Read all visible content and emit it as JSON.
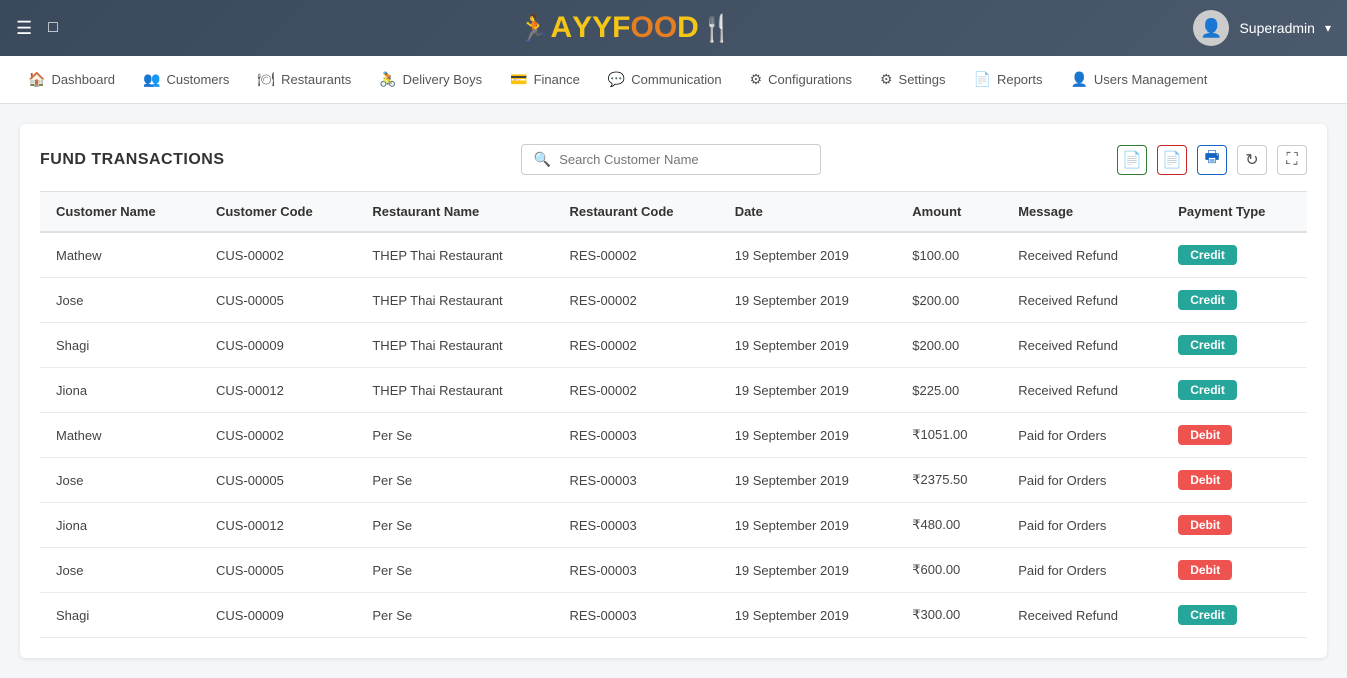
{
  "header": {
    "logo_text": "AYYFOOD",
    "user_name": "Superadmin",
    "chevron": "▾"
  },
  "navbar": {
    "items": [
      {
        "label": "Dashboard",
        "icon": "🏠"
      },
      {
        "label": "Customers",
        "icon": "👥"
      },
      {
        "label": "Restaurants",
        "icon": "🍽"
      },
      {
        "label": "Delivery Boys",
        "icon": "🚴"
      },
      {
        "label": "Finance",
        "icon": "💳"
      },
      {
        "label": "Communication",
        "icon": "💬"
      },
      {
        "label": "Configurations",
        "icon": "⚙"
      },
      {
        "label": "Settings",
        "icon": "⚙"
      },
      {
        "label": "Reports",
        "icon": "📄"
      },
      {
        "label": "Users Management",
        "icon": "👤"
      }
    ]
  },
  "page": {
    "title": "FUND TRANSACTIONS",
    "search_placeholder": "Search Customer Name"
  },
  "table": {
    "columns": [
      "Customer Name",
      "Customer Code",
      "Restaurant Name",
      "Restaurant Code",
      "Date",
      "Amount",
      "Message",
      "Payment Type"
    ],
    "rows": [
      {
        "customer_name": "Mathew",
        "customer_code": "CUS-00002",
        "restaurant_name": "THEP Thai Restaurant",
        "restaurant_code": "RES-00002",
        "date": "19 September 2019",
        "amount": "$100.00",
        "message": "Received Refund",
        "payment_type": "Credit"
      },
      {
        "customer_name": "Jose",
        "customer_code": "CUS-00005",
        "restaurant_name": "THEP Thai Restaurant",
        "restaurant_code": "RES-00002",
        "date": "19 September 2019",
        "amount": "$200.00",
        "message": "Received Refund",
        "payment_type": "Credit"
      },
      {
        "customer_name": "Shagi",
        "customer_code": "CUS-00009",
        "restaurant_name": "THEP Thai Restaurant",
        "restaurant_code": "RES-00002",
        "date": "19 September 2019",
        "amount": "$200.00",
        "message": "Received Refund",
        "payment_type": "Credit"
      },
      {
        "customer_name": "Jiona",
        "customer_code": "CUS-00012",
        "restaurant_name": "THEP Thai Restaurant",
        "restaurant_code": "RES-00002",
        "date": "19 September 2019",
        "amount": "$225.00",
        "message": "Received Refund",
        "payment_type": "Credit"
      },
      {
        "customer_name": "Mathew",
        "customer_code": "CUS-00002",
        "restaurant_name": "Per Se",
        "restaurant_code": "RES-00003",
        "date": "19 September 2019",
        "amount": "₹1051.00",
        "message": "Paid for Orders",
        "payment_type": "Debit"
      },
      {
        "customer_name": "Jose",
        "customer_code": "CUS-00005",
        "restaurant_name": "Per Se",
        "restaurant_code": "RES-00003",
        "date": "19 September 2019",
        "amount": "₹2375.50",
        "message": "Paid for Orders",
        "payment_type": "Debit"
      },
      {
        "customer_name": "Jiona",
        "customer_code": "CUS-00012",
        "restaurant_name": "Per Se",
        "restaurant_code": "RES-00003",
        "date": "19 September 2019",
        "amount": "₹480.00",
        "message": "Paid for Orders",
        "payment_type": "Debit"
      },
      {
        "customer_name": "Jose",
        "customer_code": "CUS-00005",
        "restaurant_name": "Per Se",
        "restaurant_code": "RES-00003",
        "date": "19 September 2019",
        "amount": "₹600.00",
        "message": "Paid for Orders",
        "payment_type": "Debit"
      },
      {
        "customer_name": "Shagi",
        "customer_code": "CUS-00009",
        "restaurant_name": "Per Se",
        "restaurant_code": "RES-00003",
        "date": "19 September 2019",
        "amount": "₹300.00",
        "message": "Received Refund",
        "payment_type": "Credit"
      }
    ]
  },
  "colors": {
    "credit": "#26a69a",
    "debit": "#ef5350",
    "nav_bg": "#ffffff",
    "header_bg": "#3a4a5c"
  }
}
